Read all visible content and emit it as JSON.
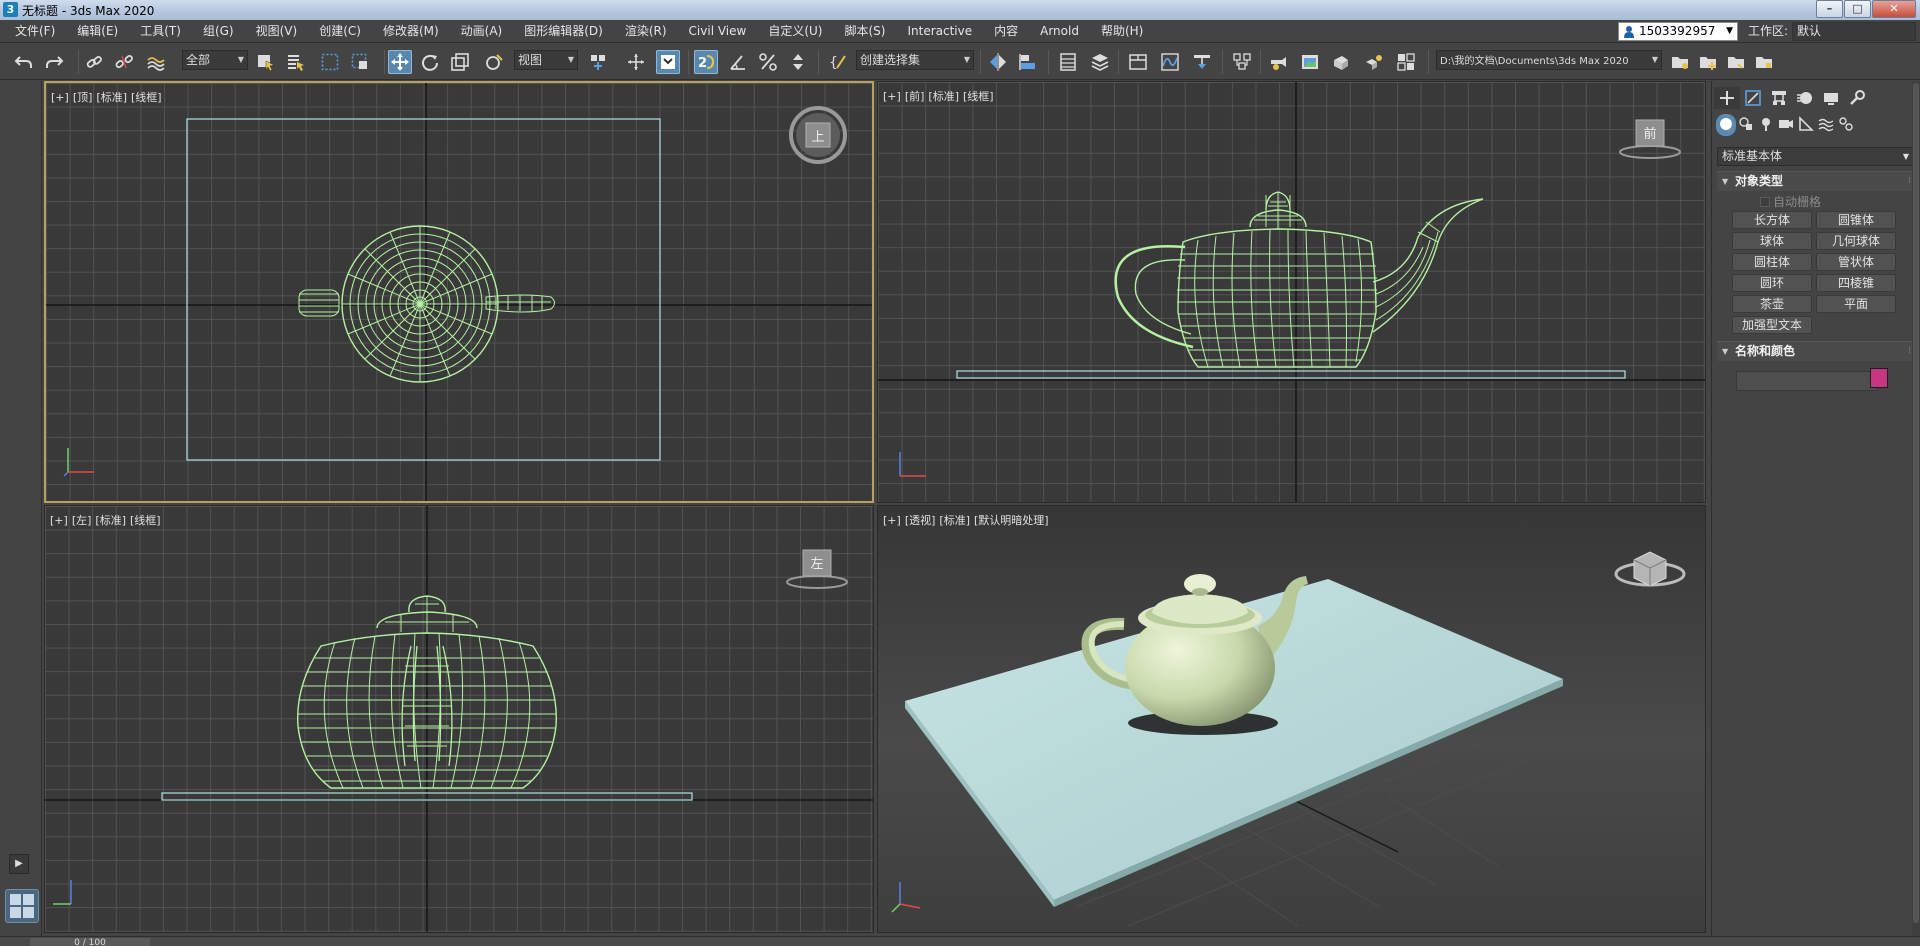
{
  "window": {
    "app_icon": "3",
    "title": "无标题 - 3ds Max 2020",
    "buttons": {
      "minimize": "–",
      "maximize": "□",
      "close": "✕"
    }
  },
  "menubar": {
    "items": [
      "文件(F)",
      "编辑(E)",
      "工具(T)",
      "组(G)",
      "视图(V)",
      "创建(C)",
      "修改器(M)",
      "动画(A)",
      "图形编辑器(D)",
      "渲染(R)",
      "Civil View",
      "自定义(U)",
      "脚本(S)",
      "Interactive",
      "内容",
      "Arnold",
      "帮助(H)"
    ],
    "user": "1503392957",
    "workspace_label": "工作区:",
    "workspace_value": "默认"
  },
  "toolbar": {
    "selection_filter": "全部",
    "reference_coord": "视图",
    "named_selection": "创建选择集",
    "project_path": "D:\\我的文档\\Documents\\3ds Max 2020",
    "icons": [
      "undo-icon",
      "redo-icon",
      "link-icon",
      "unlink-icon",
      "bind-spacewarp-icon",
      "select-object-icon",
      "select-by-name-icon",
      "rect-selection-icon",
      "window-crossing-icon",
      "select-move-icon",
      "select-rotate-icon",
      "select-scale-icon",
      "select-place-icon",
      "pivot-icon",
      "keyboard-shortcut-icon",
      "snap-toggle-icon",
      "angle-snap-icon",
      "percent-snap-icon",
      "spinner-snap-icon",
      "edit-named-sets-icon",
      "mirror-icon",
      "align-icon",
      "scene-explorer-icon",
      "layer-explorer-icon",
      "ribbon-icon",
      "curve-editor-icon",
      "schematic-view-icon",
      "material-editor-icon",
      "render-setup-icon",
      "rendered-frame-icon",
      "render-icon",
      "render-iterative-icon",
      "arnold-icon"
    ]
  },
  "viewports": {
    "top": {
      "labels": [
        "[+]",
        "[顶]",
        "[标准]",
        "[线框]"
      ],
      "cube_face": "上"
    },
    "front": {
      "labels": [
        "[+]",
        "[前]",
        "[标准]",
        "[线框]"
      ],
      "cube_face": "前"
    },
    "left": {
      "labels": [
        "[+]",
        "[左]",
        "[标准]",
        "[线框]"
      ],
      "cube_face": "左"
    },
    "perspective": {
      "labels": [
        "[+]",
        "[透视]",
        "[标准]",
        "[默认明暗处理]"
      ]
    },
    "wire_color": "#b5f0a3",
    "plane_color": "#a9d4d4"
  },
  "command_panel": {
    "category": "标准基本体",
    "object_type": {
      "title": "对象类型",
      "autogrid": "自动栅格",
      "buttons": [
        "长方体",
        "圆锥体",
        "球体",
        "几何球体",
        "圆柱体",
        "管状体",
        "圆环",
        "四棱锥",
        "茶壶",
        "平面",
        "加强型文本"
      ]
    },
    "name_color": {
      "title": "名称和颜色",
      "swatch": "#c63682"
    }
  },
  "timeline": {
    "frame": "0 / 100"
  }
}
